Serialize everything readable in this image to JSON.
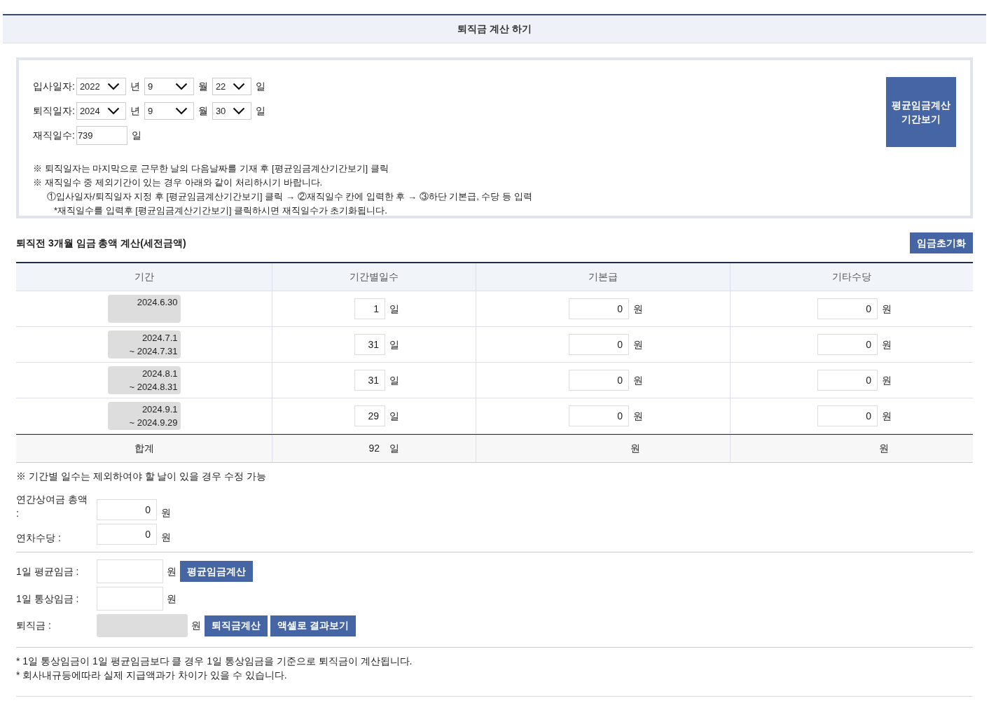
{
  "page_title": "퇴직금 계산 하기",
  "dates": [
    {
      "label": "입사일자:",
      "year": "2022",
      "year_unit": "년",
      "month": "9",
      "month_unit": "월",
      "day": "22",
      "day_unit": "일"
    },
    {
      "label": "퇴직일자:",
      "year": "2024",
      "year_unit": "년",
      "month": "9",
      "month_unit": "월",
      "day": "30",
      "day_unit": "일"
    }
  ],
  "tenure": {
    "label": "재직일수:",
    "value": "739",
    "unit": "일"
  },
  "period_button": [
    "평균임금계산",
    "기간보기"
  ],
  "notes": [
    {
      "kind": "note",
      "text": "※ 퇴직일자는 마지막으로 근무한 날의 다음날짜를 기재 후 [평균임금계산기간보기] 클릭"
    },
    {
      "kind": "note",
      "text": "※ 재직일수 중 제외기간이 있는 경우 아래와 같이 처리하시기 바랍니다."
    },
    {
      "kind": "step",
      "text": "①입사일자/퇴직일자 지정 후 [평균임금계산기간보기] 클릭 → ②재직일수 칸에 입력한 후 → ③하단 기본급, 수당 등 입력"
    },
    {
      "kind": "sub",
      "text": "*재직일수를 입력후 [평균임금계산기간보기] 클릭하시면 재직일수가 초기화됩니다."
    }
  ],
  "section_title": "퇴직전 3개월 임금 총액 계산(세전금액)",
  "reset_button": "임금초기화",
  "columns": [
    "기간",
    "기간별일수",
    "기본급",
    "기타수당"
  ],
  "rows": [
    {
      "period_start": "2024.6.30",
      "days": "1",
      "days_unit": "일",
      "base": "0",
      "base_unit": "원",
      "other": "0",
      "other_unit": "원"
    },
    {
      "period_start": "2024.7.1",
      "period_end": "~ 2024.7.31",
      "days": "31",
      "days_unit": "일",
      "base": "0",
      "base_unit": "원",
      "other": "0",
      "other_unit": "원"
    },
    {
      "period_start": "2024.8.1",
      "period_end": "~ 2024.8.31",
      "days": "31",
      "days_unit": "일",
      "base": "0",
      "base_unit": "원",
      "other": "0",
      "other_unit": "원"
    },
    {
      "period_start": "2024.9.1",
      "period_end": "~ 2024.9.29",
      "days": "29",
      "days_unit": "일",
      "base": "0",
      "base_unit": "원",
      "other": "0",
      "other_unit": "원"
    }
  ],
  "total": {
    "label": "합계",
    "days": "92",
    "days_unit": "일",
    "base_unit": "원",
    "other_unit": "원"
  },
  "table_note": "※ 기간별 일수는 제외하여야 할 날이 있을 경우 수정 가능",
  "extras": [
    {
      "label": "연간상여금 총액 :",
      "value": "0",
      "unit": "원"
    },
    {
      "label": "연차수당 :",
      "value": "0",
      "unit": "원"
    }
  ],
  "results": [
    {
      "label": "1일 평균임금 :",
      "readonly": false,
      "unit": "원",
      "buttons": [
        "평균임금계산"
      ]
    },
    {
      "label": "1일 통상임금 :",
      "readonly": false,
      "unit": "원"
    },
    {
      "label": "퇴직금 :",
      "readonly": true,
      "unit": "원",
      "buttons": [
        "퇴직금계산",
        "액셀로 결과보기"
      ]
    }
  ],
  "footnotes": [
    "* 1일 통상임금이 1일 평균임금보다 클 경우 1일 통상임금을 기준으로 퇴직금이 계산됩니다.",
    "* 회사내규등에따라 실제 지급액과가 차이가 있을 수 있습니다."
  ]
}
